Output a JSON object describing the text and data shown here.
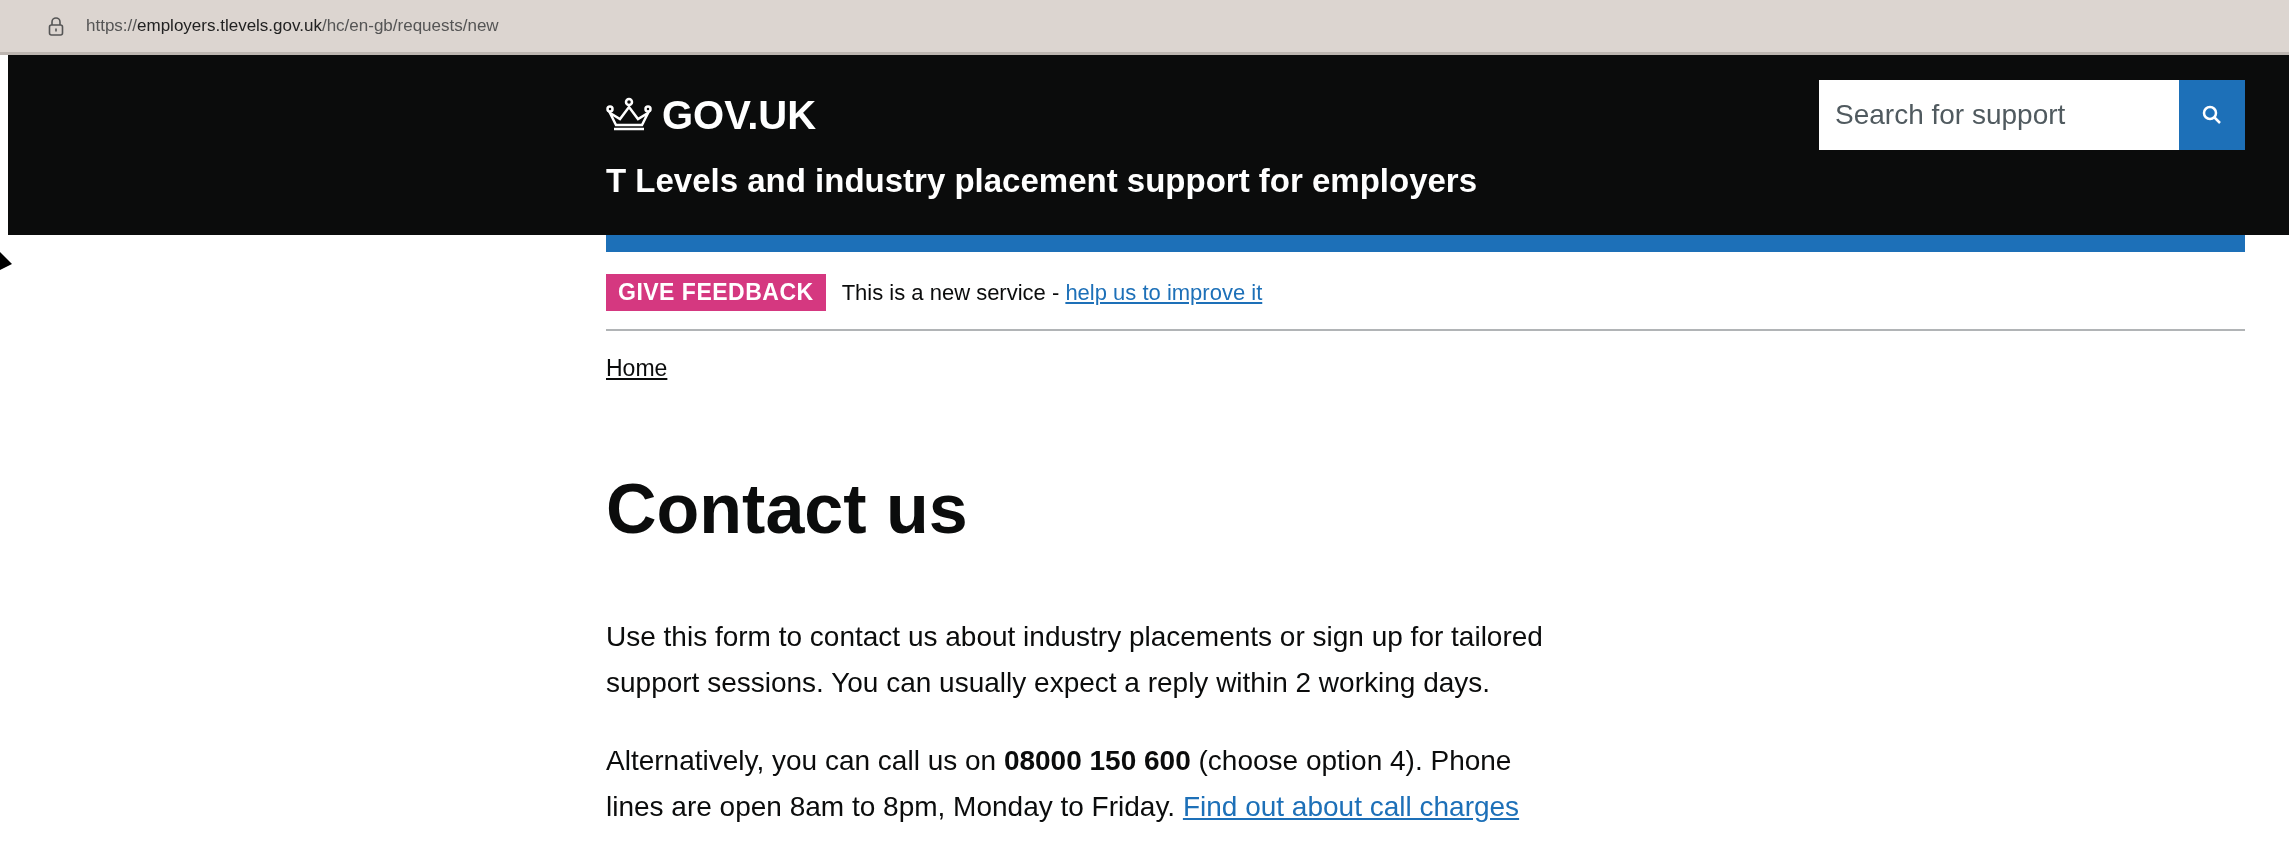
{
  "browser": {
    "url_host_prefix": "https://",
    "url_host": "employers.tlevels.gov.uk",
    "url_path": "/hc/en-gb/requests/new"
  },
  "header": {
    "logo": "GOV.UK",
    "service_name": "T Levels and industry placement support for employers",
    "search": {
      "placeholder": "Search for support"
    }
  },
  "banner": {
    "tag": "GIVE FEEDBACK",
    "text": "This is a new service - ",
    "link": "help us to improve it"
  },
  "breadcrumbs": [
    {
      "label": "Home"
    }
  ],
  "heading": "Contact us",
  "paragraphs": [
    {
      "lines": [
        "Use this form to contact us about industry placements or sign up for tailored",
        "support sessions. You can usually expect a reply within 2 working days."
      ]
    },
    {
      "lines": [
        "Alternatively, you can call us on **08000 150 600** (choose option 4). Phone",
        "lines are open 8am to 8pm, Monday to Friday. "
      ],
      "link": "Find out about call charges"
    }
  ]
}
